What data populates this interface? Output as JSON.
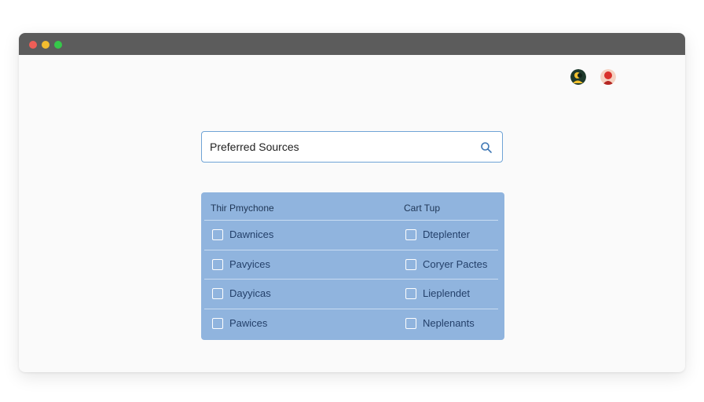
{
  "window": {
    "controls": {
      "close_color": "#ee5e57",
      "minimize_color": "#f4bd2f",
      "maximize_color": "#35c84a"
    }
  },
  "header": {
    "avatars": [
      {
        "icon": "user-avatar-dark",
        "colors": [
          "#1e3a2c",
          "#f2c12e"
        ]
      },
      {
        "icon": "user-avatar-red",
        "colors": [
          "#d9312b",
          "#f5d2c2"
        ]
      }
    ]
  },
  "search": {
    "value": "Preferred Sources",
    "placeholder": "Preferred Sources",
    "icon": "search-icon"
  },
  "options_panel": {
    "columns": [
      {
        "header": "Thir Pmychone"
      },
      {
        "header": "Cart Tup"
      }
    ],
    "rows": [
      {
        "left": {
          "label": "Dawnices",
          "checked": false
        },
        "right": {
          "label": "Dteplenter",
          "checked": false
        }
      },
      {
        "left": {
          "label": "Pavyices",
          "checked": false
        },
        "right": {
          "label": "Coryer Pactes",
          "checked": false
        }
      },
      {
        "left": {
          "label": "Dayyicas",
          "checked": false
        },
        "right": {
          "label": "Lieplendet",
          "checked": false
        }
      },
      {
        "left": {
          "label": "Pawices",
          "checked": false
        },
        "right": {
          "label": "Neplenants",
          "checked": false
        }
      }
    ]
  },
  "colors": {
    "panel": "#90b4de",
    "search_border": "#6fa3d6",
    "titlebar": "#5c5c5c"
  }
}
